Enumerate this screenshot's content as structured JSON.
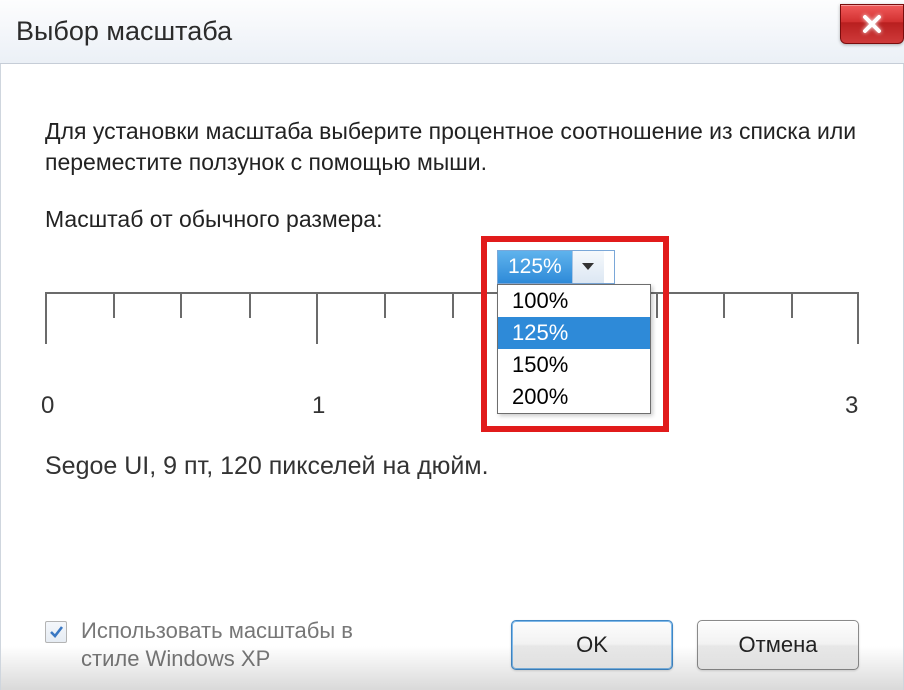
{
  "window": {
    "title": "Выбор масштаба"
  },
  "main": {
    "instruction": "Для установки масштаба выберите процентное соотношение из списка или переместите ползунок с помощью мыши.",
    "scale_label": "Масштаб от обычного размера:",
    "selected": "125%",
    "options": [
      "100%",
      "125%",
      "150%",
      "200%"
    ],
    "ruler_labels": [
      "0",
      "1",
      "3"
    ],
    "font_info": "Segoe UI, 9 пт, 120 пикселей на дюйм."
  },
  "footer": {
    "checkbox_label": "Использовать масштабы в стиле Windows XP",
    "ok": "OK",
    "cancel": "Отмена"
  }
}
